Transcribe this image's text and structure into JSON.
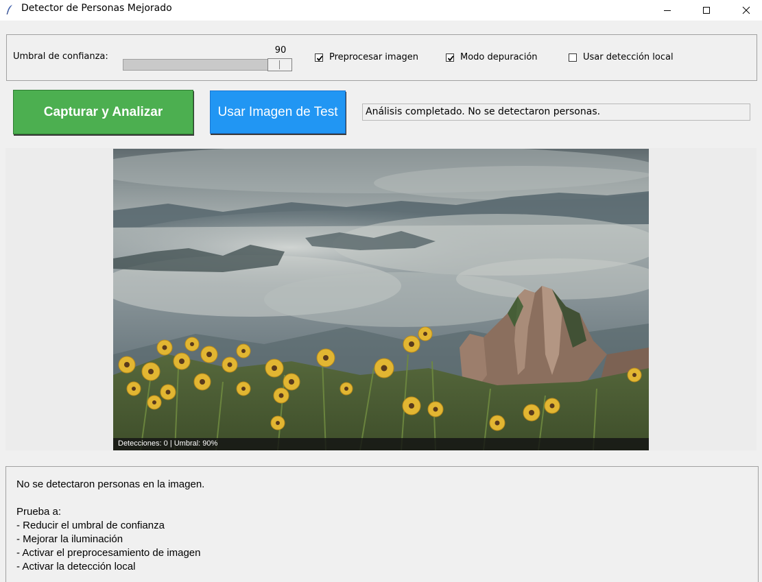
{
  "window": {
    "title": "Detector de Personas Mejorado",
    "minimize_icon": "minimize-icon",
    "maximize_icon": "maximize-icon",
    "close_icon": "close-icon"
  },
  "options": {
    "threshold_label": "Umbral de confianza:",
    "threshold_value": "90",
    "threshold_fraction": 0.9,
    "checkboxes": [
      {
        "label": "Preprocesar imagen",
        "checked": true
      },
      {
        "label": "Modo depuración",
        "checked": true
      },
      {
        "label": "Usar detección local",
        "checked": false
      }
    ]
  },
  "actions": {
    "capture_label": "Capturar y Analizar",
    "capture_color": "#4caf50",
    "test_label": "Usar Imagen de Test",
    "test_color": "#2196f3",
    "status_text": "Análisis completado. No se detectaron personas."
  },
  "image": {
    "overlay_text": "Detecciones: 0 | Umbral: 90%"
  },
  "results": {
    "lines": [
      "No se detectaron personas en la imagen.",
      "",
      "Prueba a:",
      "- Reducir el umbral de confianza",
      "- Mejorar la iluminación",
      "- Activar el preprocesamiento de imagen",
      "- Activar la detección local"
    ]
  }
}
